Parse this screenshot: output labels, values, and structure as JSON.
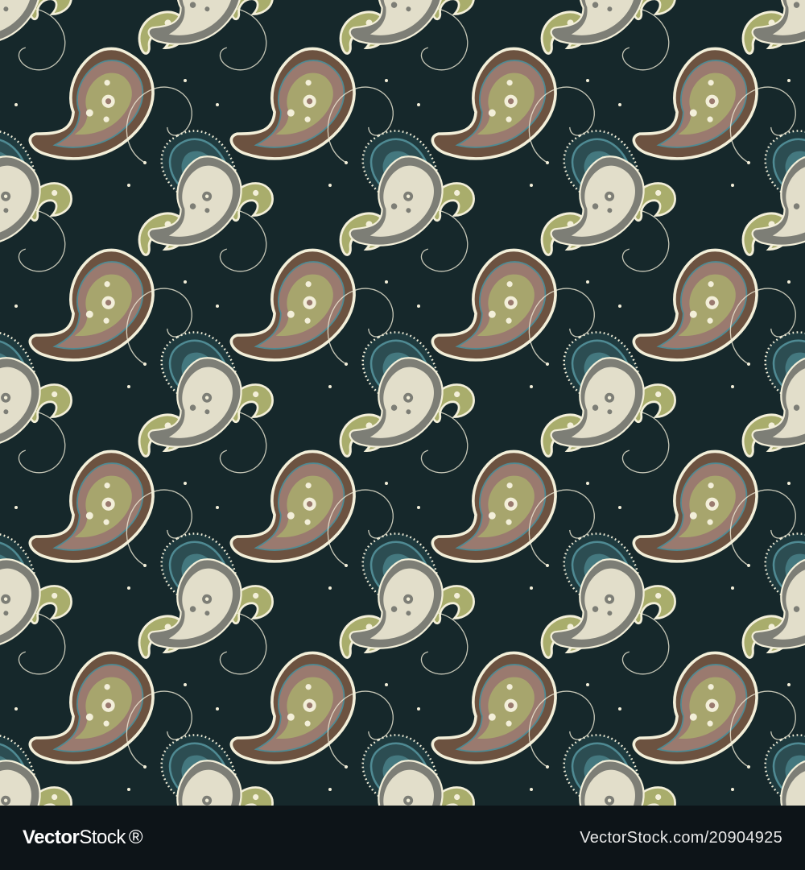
{
  "image": {
    "subject": "seamless-paisley-pattern",
    "colors": {
      "background": "#16282b",
      "cream": "#f3efd9",
      "olive": "#a9ad6c",
      "mauve": "#9a7a6f",
      "teal": "#4f8a93",
      "gray": "#7d7e76",
      "brown": "#6c5240",
      "footer": "#0d1418"
    }
  },
  "footer": {
    "logo_prefix": "Vector",
    "logo_suffix": "Stock",
    "logo_mark": "®",
    "credit": "VectorStock.com/20904925"
  }
}
